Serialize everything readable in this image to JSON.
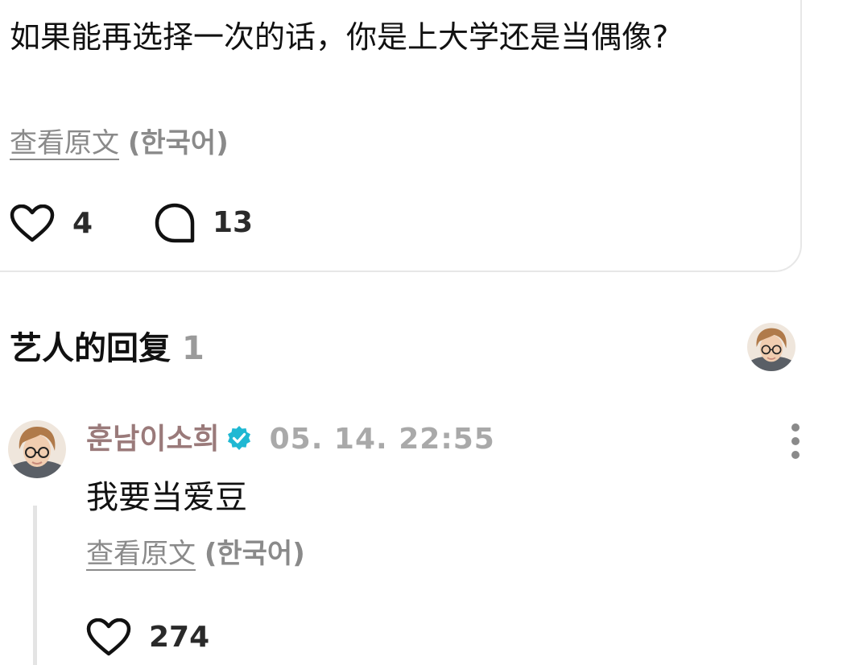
{
  "post": {
    "text": "如果能再选择一次的话，你是上大学还是当偶像?",
    "translate_link": "查看原文",
    "translate_lang": "(한국어)",
    "likes": "4",
    "comments": "13"
  },
  "artist_replies": {
    "title": "艺人的回复",
    "count": "1"
  },
  "reply": {
    "author": "훈남이소희",
    "time": "05. 14. 22:55",
    "text": "我要当爱豆",
    "translate_link": "查看原文",
    "translate_lang": "(한국어)",
    "likes": "274"
  },
  "colors": {
    "verified": "#1fb8d3",
    "author": "#9a7a7a",
    "muted": "#8a8a8a"
  },
  "icons": {
    "like": "heart-icon",
    "comment": "comment-bubble-icon",
    "verified": "verified-badge-icon",
    "more": "more-vertical-icon"
  }
}
